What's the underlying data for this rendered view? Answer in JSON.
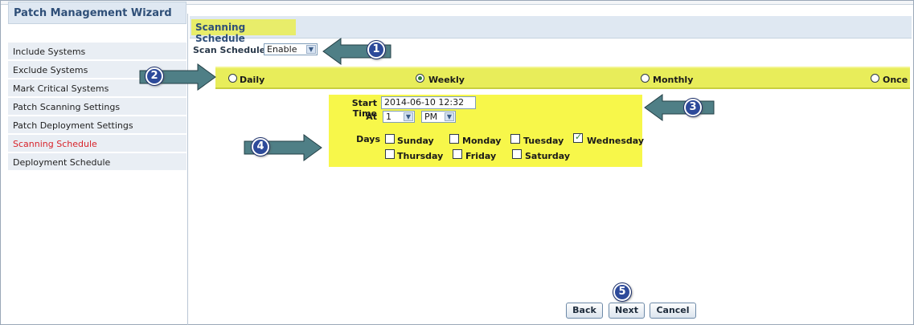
{
  "sidebar": {
    "title": "Patch Management Wizard",
    "items": [
      {
        "label": "Include Systems"
      },
      {
        "label": "Exclude Systems"
      },
      {
        "label": "Mark Critical Systems"
      },
      {
        "label": "Patch Scanning Settings"
      },
      {
        "label": "Patch Deployment Settings"
      },
      {
        "label": "Scanning Schedule",
        "active": true
      },
      {
        "label": "Deployment Schedule"
      }
    ]
  },
  "main": {
    "title": "Scanning Schedule",
    "scan_scheduler": {
      "label": "Scan Scheduler",
      "value": "Enable"
    },
    "frequency": {
      "options": [
        "Daily",
        "Weekly",
        "Monthly",
        "Once"
      ],
      "selected": "Weekly"
    },
    "schedule": {
      "start_time_label": "Start Time",
      "start_time_value": "2014-06-10 12:32",
      "at_label": "At",
      "hour_value": "1",
      "ampm_value": "PM",
      "days_label": "Days",
      "days": [
        {
          "label": "Sunday",
          "checked": false
        },
        {
          "label": "Monday",
          "checked": false
        },
        {
          "label": "Tuesday",
          "checked": false
        },
        {
          "label": "Wednesday",
          "checked": true
        },
        {
          "label": "Thursday",
          "checked": false
        },
        {
          "label": "Friday",
          "checked": false
        },
        {
          "label": "Saturday",
          "checked": false
        }
      ]
    },
    "buttons": {
      "back": "Back",
      "next": "Next",
      "cancel": "Cancel"
    }
  },
  "callouts": [
    "1",
    "2",
    "3",
    "4",
    "5"
  ],
  "colors": {
    "highlight": "#e8ed5a",
    "arrow": "#4f7f86",
    "badge": "#2d4a9a",
    "active_item": "#d8232a"
  }
}
